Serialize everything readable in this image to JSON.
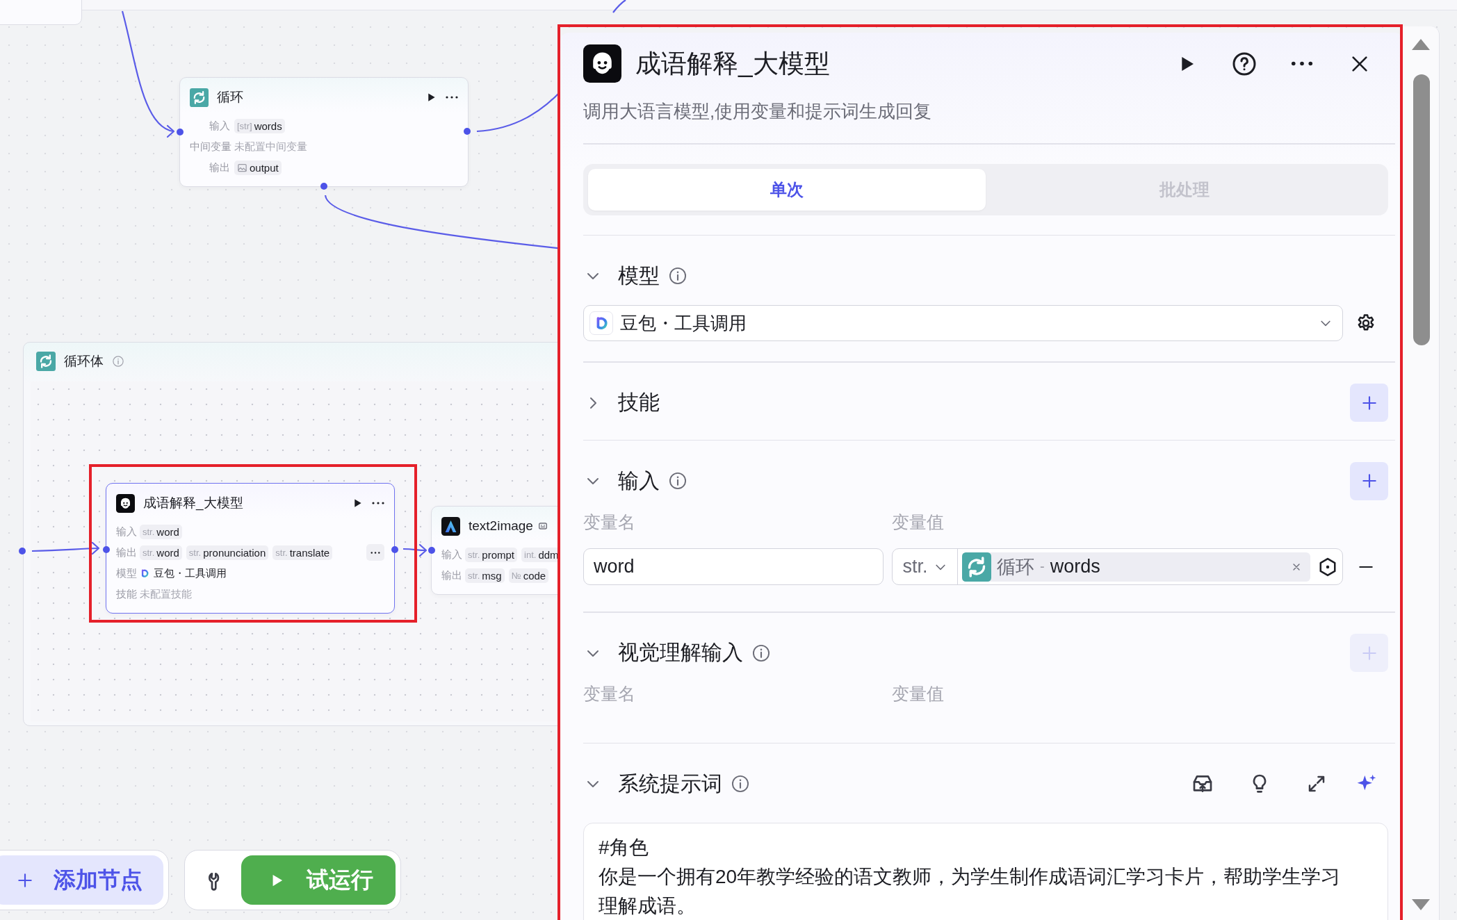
{
  "canvas": {
    "loop_node": {
      "title": "循环",
      "selected": false,
      "rows": [
        {
          "kind": "tags",
          "label": "输入",
          "tags": [
            {
              "kind": "typed",
              "type": "[str]",
              "name": "words"
            }
          ]
        },
        {
          "kind": "text",
          "label": "中间变量",
          "value": "未配置中间变量"
        },
        {
          "kind": "tags",
          "label": "输出",
          "tags": [
            {
              "kind": "image",
              "name": "output"
            }
          ]
        }
      ]
    },
    "loop_body": {
      "title": "循环体"
    },
    "llm_node": {
      "title": "成语解释_大模型",
      "selected": true,
      "highlighted": true,
      "rows": [
        {
          "kind": "tags",
          "label": "输入",
          "tags": [
            {
              "kind": "typed",
              "type": "str.",
              "name": "word"
            }
          ]
        },
        {
          "kind": "tags",
          "label": "输出",
          "overflow": true,
          "tags": [
            {
              "kind": "typed",
              "type": "str.",
              "name": "word"
            },
            {
              "kind": "typed",
              "type": "str.",
              "name": "pronunciation"
            },
            {
              "kind": "typed",
              "type": "str.",
              "name": "translate"
            }
          ]
        },
        {
          "kind": "model",
          "label": "模型",
          "value": "豆包・工具调用"
        },
        {
          "kind": "text",
          "label": "技能",
          "value": "未配置技能"
        }
      ]
    },
    "text2image_node": {
      "title": "text2image",
      "selected": false,
      "rows": [
        {
          "kind": "tags",
          "label": "输入",
          "tags": [
            {
              "kind": "typed",
              "type": "str.",
              "name": "prompt"
            },
            {
              "kind": "typed",
              "type": "int.",
              "name": "ddm"
            }
          ]
        },
        {
          "kind": "tags",
          "label": "输出",
          "tags": [
            {
              "kind": "typed",
              "type": "str.",
              "name": "msg"
            },
            {
              "kind": "typed",
              "type": "№",
              "name": "code"
            }
          ]
        }
      ]
    }
  },
  "toolbar": {
    "add_node": "添加节点",
    "test_run": "试运行"
  },
  "panel": {
    "highlighted": true,
    "title": "成语解释_大模型",
    "description": "调用大语言模型,使用变量和提示词生成回复",
    "tabs": [
      {
        "label": "单次",
        "selected": true
      },
      {
        "label": "批处理",
        "selected": false
      }
    ],
    "sections": [
      {
        "kind": "model",
        "title": "模型",
        "expanded": true,
        "info": true,
        "model": "豆包・工具调用"
      },
      {
        "kind": "skills",
        "title": "技能",
        "expanded": false,
        "add_disabled": false
      },
      {
        "kind": "inputs",
        "title": "输入",
        "expanded": true,
        "info": true,
        "add_disabled": false,
        "columns": [
          "变量名",
          "变量值"
        ],
        "rows": [
          {
            "name": "word",
            "type": "str.",
            "ref_node": "循环",
            "ref_sep": "-",
            "ref_var": "words"
          }
        ]
      },
      {
        "kind": "inputs",
        "title": "视觉理解输入",
        "expanded": true,
        "info": true,
        "add_disabled": true,
        "columns": [
          "变量名",
          "变量值"
        ]
      },
      {
        "kind": "prompt",
        "title": "系统提示词",
        "expanded": true,
        "info": true,
        "lines": [
          "#角色",
          "你是一个拥有20年教学经验的语文教师，为学生制作成语词汇学习卡片，帮助学生学习理解成语。"
        ]
      }
    ]
  }
}
